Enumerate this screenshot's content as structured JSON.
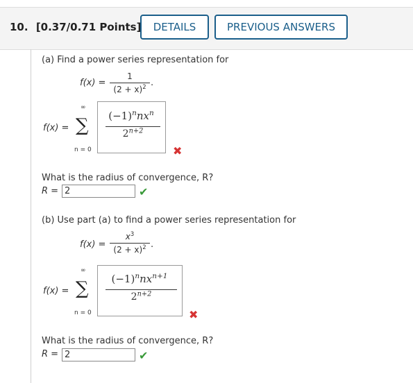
{
  "header": {
    "question_number": "10.",
    "points": "[0.37/0.71 Points]",
    "details_label": "DETAILS",
    "previous_label": "PREVIOUS ANSWERS"
  },
  "part_a": {
    "prompt": "(a) Find a power series representation for",
    "given_lhs": "f(x) =",
    "given_num": "1",
    "given_den": "(2 + x)",
    "given_den_exp": "2",
    "given_end": ".",
    "series_lhs": "f(x) =",
    "sum_upper": "∞",
    "sum_lower": "n = 0",
    "answer_num_base": "(−1)",
    "answer_num_exp1": "n",
    "answer_num_mid": "nx",
    "answer_num_exp2": "n",
    "answer_den_base": "2",
    "answer_den_exp": "n+2",
    "answer_status": "incorrect",
    "radius_question": "What is the radius of convergence, R?",
    "radius_label": "R =",
    "radius_value": "2",
    "radius_status": "correct"
  },
  "part_b": {
    "prompt": "(b) Use part (a) to find a power series representation for",
    "given_lhs": "f(x) =",
    "given_num": "x",
    "given_num_exp": "3",
    "given_den": "(2 + x)",
    "given_den_exp": "2",
    "given_end": ".",
    "series_lhs": "f(x) =",
    "sum_upper": "∞",
    "sum_lower": "n = 0",
    "answer_num_base": "(−1)",
    "answer_num_exp1": "n",
    "answer_num_mid": "nx",
    "answer_num_exp2": "n+1",
    "answer_den_base": "2",
    "answer_den_exp": "n+2",
    "answer_status": "incorrect",
    "radius_question": "What is the radius of convergence, R?",
    "radius_label": "R =",
    "radius_value": "2",
    "radius_status": "correct"
  },
  "icons": {
    "wrong": "✖",
    "right": "✔"
  },
  "colors": {
    "accent": "#1a5e8a",
    "wrong": "#d63333",
    "right": "#3a9a3a"
  }
}
